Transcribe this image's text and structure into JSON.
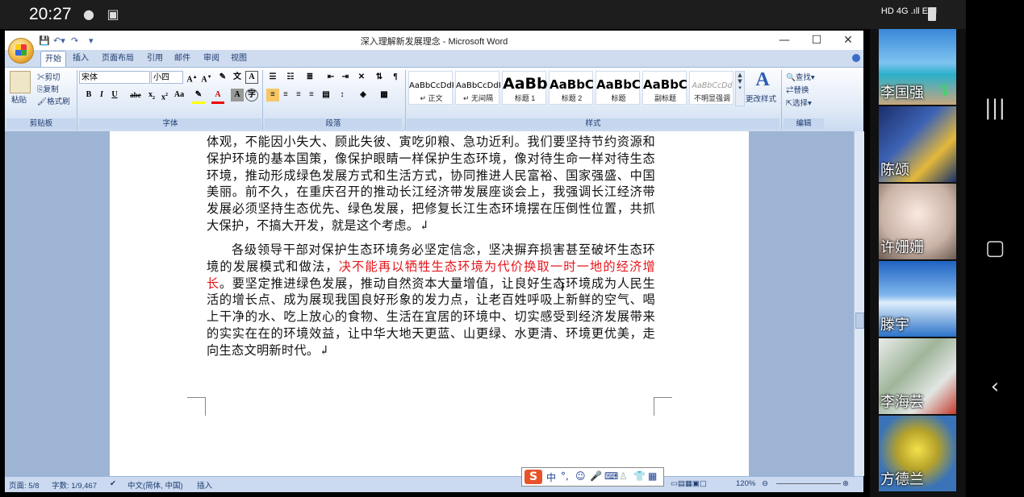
{
  "status_bar": {
    "time": "20:27",
    "network": "HD 4G .ıll E.ıll"
  },
  "window": {
    "title": "深入理解新发展理念 - Microsoft Word",
    "controls": {
      "minimize": "—",
      "maximize": "☐",
      "close": "✕"
    }
  },
  "tabs": [
    "开始",
    "插入",
    "页面布局",
    "引用",
    "邮件",
    "审阅",
    "视图"
  ],
  "clipboard": {
    "paste": "粘贴",
    "cut": "剪切",
    "copy": "复制",
    "format_painter": "格式刷",
    "group": "剪贴板"
  },
  "font": {
    "name": "宋体",
    "size": "小四",
    "group": "字体"
  },
  "paragraph": {
    "group": "段落"
  },
  "styles": {
    "group": "样式",
    "items": [
      {
        "preview": "AaBbCcDdI",
        "name": "↵ 正文"
      },
      {
        "preview": "AaBbCcDdI",
        "name": "↵ 无间隔"
      },
      {
        "preview": "AaBb",
        "name": "标题 1"
      },
      {
        "preview": "AaBbC",
        "name": "标题 2"
      },
      {
        "preview": "AaBbC",
        "name": "标题"
      },
      {
        "preview": "AaBbC",
        "name": "副标题"
      },
      {
        "preview": "AaBbCcDd",
        "name": "不明显强调"
      }
    ],
    "change": "更改样式"
  },
  "editing": {
    "find": "查找",
    "replace": "替换",
    "select": "选择",
    "group": "编辑"
  },
  "document": {
    "para1": "体观，不能因小失大、顾此失彼、寅吃卯粮、急功近利。我们要坚持节约资源和保护环境的基本国策，像保护眼睛一样保护生态环境，像对待生命一样对待生态环境，推动形成绿色发展方式和生活方式，协同推进人民富裕、国家强盛、中国美丽。前不久，在重庆召开的推动长江经济带发展座谈会上，我强调长江经济带发展必须坚持生态优先、绿色发展，把修复长江生态环境摆在压倒性位置，共抓大保护，不搞大开发，就是这个考虑。↲",
    "para2_start": "各级领导干部对保护生态环境务必坚定信念，坚决摒弃损害甚至破坏生态环境的发展模式和做法，",
    "para2_red": "决不能再以牺牲生态环境为代价换取一时一地的经济增长",
    "para2_end": "。要坚定推进绿色发展，推动自然资本大量增值，让良好生态环境成为人民生活的增长点、成为展现我国良好形象的发力点，让老百姓呼吸上新鲜的空气、喝上干净的水、吃上放心的食物、生活在宜居的环境中、切实感受到经济发展带来的实实在在的环境效益，让中华大地天更蓝、山更绿、水更清、环境更优美，走向生态文明新时代。↲"
  },
  "status": {
    "page": "页面: 5/8",
    "words": "字数: 1/9,467",
    "language": "中文(简体, 中国)",
    "mode": "插入",
    "zoom": "120%"
  },
  "ime": {
    "label": "中"
  },
  "participants": [
    "李国强",
    "陈颂",
    "许姗姗",
    "滕宇",
    "李海芸",
    "方德兰"
  ],
  "accent": "#e5141b"
}
